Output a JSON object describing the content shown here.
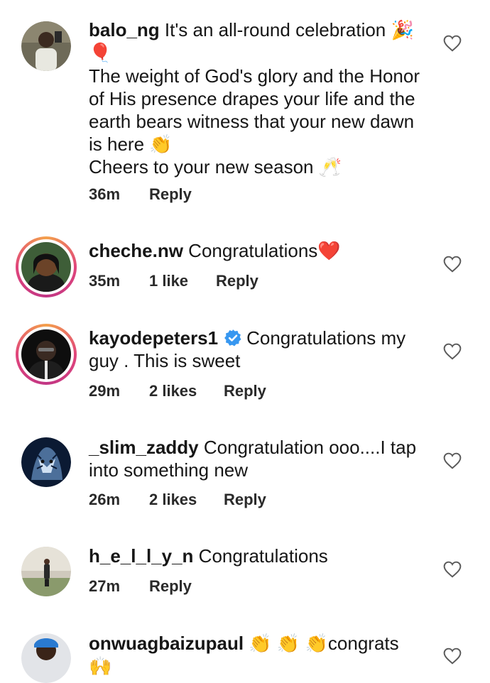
{
  "comments": [
    {
      "username": "balo_ng",
      "text_line1": " It's an all-round celebration 🎉",
      "text_line2": "🎈",
      "text_line3": "The weight of God's glory and the Honor of His presence drapes your life and the earth bears witness that your new dawn is here 👏",
      "text_line4": "Cheers to your new season 🥂",
      "time": "36m",
      "likes": "",
      "reply": "Reply"
    },
    {
      "username": "cheche.nw",
      "text": " Congratulations❤️",
      "time": "35m",
      "likes": "1 like",
      "reply": "Reply"
    },
    {
      "username": "kayodepeters1",
      "text": "Congratulations my guy . This is sweet",
      "time": "29m",
      "likes": "2 likes",
      "reply": "Reply"
    },
    {
      "username": "_slim_zaddy",
      "text": " Congratulation ooo....I tap into something new",
      "time": "26m",
      "likes": "2 likes",
      "reply": "Reply"
    },
    {
      "username": "h_e_l_l_y_n",
      "text": " Congratulations",
      "time": "27m",
      "likes": "",
      "reply": "Reply"
    },
    {
      "username": "onwuagbaizupaul",
      "text": " 👏 👏 👏congrats 🙌"
    }
  ],
  "icons": {
    "like": "heart-outline-icon",
    "verified": "verified-badge-icon"
  },
  "colors": {
    "verified": "#3797f0",
    "story_ring_start": "#f4a04b",
    "story_ring_end": "#c13584"
  }
}
